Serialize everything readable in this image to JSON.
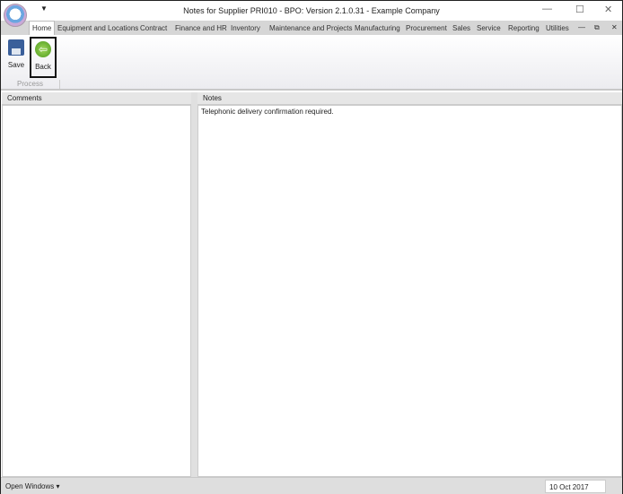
{
  "window": {
    "title": "Notes for Supplier PRI010 - BPO: Version 2.1.0.31 - Example Company"
  },
  "tabs": [
    "Home",
    "Equipment and Locations",
    "Contract",
    "Finance and HR",
    "Inventory",
    "Maintenance and Projects",
    "Manufacturing",
    "Procurement",
    "Sales",
    "Service",
    "Reporting",
    "Utilities"
  ],
  "ribbon": {
    "save": "Save",
    "back": "Back",
    "group": "Process"
  },
  "comments": {
    "header": "Comments"
  },
  "notes": {
    "header": "Notes",
    "text": "Telephonic delivery confirmation required."
  },
  "status": {
    "open_windows": "Open Windows",
    "date": "10 Oct 2017"
  }
}
